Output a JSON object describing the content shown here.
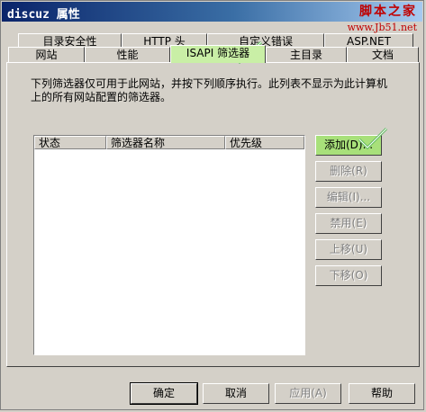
{
  "window": {
    "title": "discuz 属性"
  },
  "watermark": {
    "line1": "脚本之家",
    "line2": "www.Jb51.net"
  },
  "tabs_row1": [
    {
      "label": "目录安全性"
    },
    {
      "label": "HTTP 头"
    },
    {
      "label": "自定义错误"
    },
    {
      "label": "ASP.NET"
    }
  ],
  "tabs_row2": [
    {
      "label": "网站"
    },
    {
      "label": "性能"
    },
    {
      "label": "ISAPI 筛选器",
      "active": true
    },
    {
      "label": "主目录"
    },
    {
      "label": "文档"
    }
  ],
  "panel": {
    "description": "下列筛选器仅可用于此网站，并按下列顺序执行。此列表不显示为此计算机上的所有网站配置的筛选器。",
    "columns": [
      "状态",
      "筛选器名称",
      "优先级"
    ],
    "rows": []
  },
  "side_buttons": {
    "add": "添加(D)...",
    "remove": "删除(R)",
    "edit": "编辑(I)...",
    "disable": "禁用(E)",
    "move_up": "上移(U)",
    "move_down": "下移(O)"
  },
  "footer_buttons": {
    "ok": "确定",
    "cancel": "取消",
    "apply": "应用(A)",
    "help": "帮助"
  },
  "colors": {
    "highlight_green": "#a8e07a",
    "check_green": "#5cb85c",
    "watermark_red": "#c00000"
  }
}
